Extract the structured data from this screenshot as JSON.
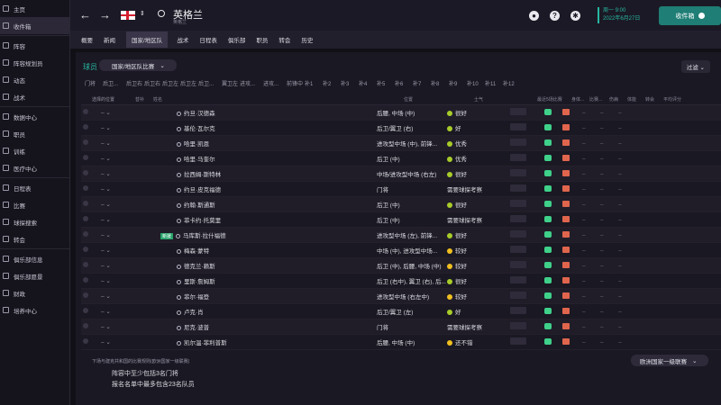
{
  "sidebar": {
    "items": [
      {
        "label": "主页",
        "active": false
      },
      {
        "label": "收件箱",
        "active": true
      },
      {
        "label": "阵容",
        "active": false
      },
      {
        "label": "阵容规划员",
        "active": false
      },
      {
        "label": "动态",
        "active": false
      },
      {
        "label": "战术",
        "active": false
      },
      {
        "label": "数据中心",
        "active": false
      },
      {
        "label": "职员",
        "active": false
      },
      {
        "label": "训练",
        "active": false
      },
      {
        "label": "医疗中心",
        "active": false
      },
      {
        "label": "日程表",
        "active": false
      },
      {
        "label": "比赛",
        "active": false
      },
      {
        "label": "球探搜索",
        "active": false
      },
      {
        "label": "转会",
        "active": false
      },
      {
        "label": "俱乐部信息",
        "active": false
      },
      {
        "label": "俱乐部愿景",
        "active": false
      },
      {
        "label": "财政",
        "active": false
      },
      {
        "label": "培养中心",
        "active": false
      }
    ]
  },
  "header": {
    "title": "英格兰",
    "subtitle": "英格兰",
    "date_line1": "周一 9:00",
    "date_line2": "2022年6月27日",
    "inbox_button": "收件箱"
  },
  "menu": [
    "概要",
    "新闻",
    "国家/地区队",
    "战术",
    "日程表",
    "俱乐部",
    "职员",
    "转会",
    "历史"
  ],
  "main": {
    "players_label": "球员",
    "squad_dropdown": "国家/地区队比赛",
    "filter_label": "过滤",
    "position_tabs": [
      "门将",
      "后卫...",
      "后卫右",
      "后卫右",
      "后卫左",
      "后卫左",
      "后卫...",
      "翼卫左",
      "进攻...",
      "进攻...",
      "前锋中",
      "补1",
      "补2",
      "补3",
      "补4",
      "补5",
      "补6",
      "补7",
      "补8",
      "补9",
      "补10",
      "补11",
      "补12"
    ],
    "columns": [
      "选择的位置",
      "",
      "替补",
      "姓名",
      "位置",
      "士气",
      "最近5场比赛",
      "身体...",
      "比赛...",
      "伤病",
      "体能",
      "转会",
      "平均评分"
    ]
  },
  "players": [
    {
      "name": "约旦·汉德森",
      "position": "后腰, 中场 (中)",
      "morale": "很好",
      "tag": ""
    },
    {
      "name": "基伦·瓦尔克",
      "position": "后卫/翼卫 (右)",
      "morale": "好",
      "tag": ""
    },
    {
      "name": "哈里·凯恩",
      "position": "进攻型中场 (中), 前锋...",
      "morale": "优秀",
      "tag": ""
    },
    {
      "name": "哈里·马奎尔",
      "position": "后卫 (中)",
      "morale": "优秀",
      "tag": ""
    },
    {
      "name": "拉西姆·斯特林",
      "position": "中场/进攻型中场 (右左)",
      "morale": "很好",
      "tag": ""
    },
    {
      "name": "约旦·皮克福德",
      "position": "门将",
      "morale": "需要球探考察",
      "tag": ""
    },
    {
      "name": "约翰·斯通斯",
      "position": "后卫 (中)",
      "morale": "很好",
      "tag": ""
    },
    {
      "name": "菲卡约·托莫里",
      "position": "后卫 (中)",
      "morale": "需要球探考察",
      "tag": ""
    },
    {
      "name": "马库斯·拉什福德",
      "position": "进攻型中场 (左), 前锋...",
      "morale": "很好",
      "tag": "新援"
    },
    {
      "name": "梅森·蒙特",
      "position": "中场 (中), 进攻型中场...",
      "morale": "较好",
      "tag": ""
    },
    {
      "name": "德克兰·赖斯",
      "position": "后卫 (中), 后腰, 中场 (中)",
      "morale": "较好",
      "tag": ""
    },
    {
      "name": "里斯·詹姆斯",
      "position": "后卫 (右中), 翼卫 (右), 后...",
      "morale": "很好",
      "tag": ""
    },
    {
      "name": "菲尔·福登",
      "position": "进攻型中场 (右左中)",
      "morale": "较好",
      "tag": ""
    },
    {
      "name": "卢克·肖",
      "position": "后卫/翼卫 (左)",
      "morale": "好",
      "tag": ""
    },
    {
      "name": "尼克·波普",
      "position": "门将",
      "morale": "需要球探考察",
      "tag": ""
    },
    {
      "name": "凯尔温·菲利普斯",
      "position": "后腰, 中场 (中)",
      "morale": "还不错",
      "tag": ""
    }
  ],
  "footer": {
    "note": "下场与建克共和国的比赛规则(欧洲国家一级联赛)",
    "line1": "阵容中至少包括3名门将",
    "line2": "报名名单中最多包含23名队员",
    "competition_dropdown": "欧洲国家一级联赛"
  },
  "colors": {
    "accent": "#27b6a2",
    "background": "#111016",
    "panel": "#1a1822"
  }
}
